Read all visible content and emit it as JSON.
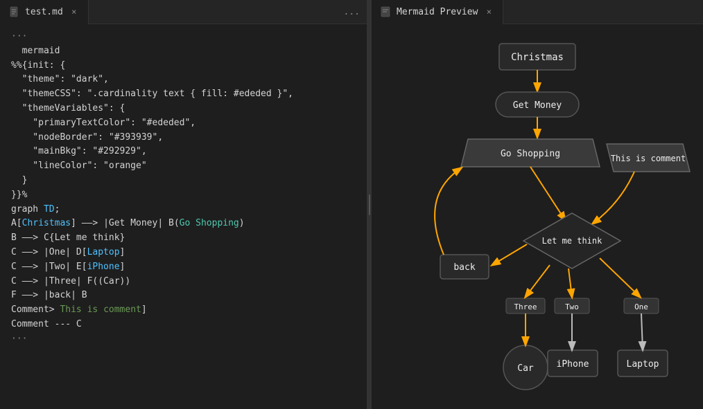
{
  "editor": {
    "tab": {
      "label": "test.md",
      "close_icon": "×",
      "more_icon": "..."
    },
    "lines": [
      {
        "id": 1,
        "content": "···",
        "class": "c-gray"
      },
      {
        "id": 2,
        "content": "  mermaid",
        "class": "c-white"
      },
      {
        "id": 3,
        "content": "%%{init: {",
        "class": "c-white"
      },
      {
        "id": 4,
        "content": "  \"theme\": \"dark\",",
        "class": "c-white"
      },
      {
        "id": 5,
        "content": "  \"themeCSS\": \".cardinality text { fill: #ededed }\",",
        "class": "c-white"
      },
      {
        "id": 6,
        "content": "  \"themeVariables\": {",
        "class": "c-white"
      },
      {
        "id": 7,
        "content": "    \"primaryTextColor\": \"#ededed\",",
        "class": "c-white"
      },
      {
        "id": 8,
        "content": "    \"nodeBorder\": \"#393939\",",
        "class": "c-white"
      },
      {
        "id": 9,
        "content": "    \"mainBkg\": \"#292929\",",
        "class": "c-white"
      },
      {
        "id": 10,
        "content": "    \"lineColor\": \"orange\"",
        "class": "c-white"
      },
      {
        "id": 11,
        "content": "  }",
        "class": "c-white"
      },
      {
        "id": 12,
        "content": "}}%",
        "class": "c-white"
      },
      {
        "id": 13,
        "content": "graph TD;",
        "class": "c-white"
      },
      {
        "id": 14,
        "content": "A[Christmas] --> |Get Money| B(Go Shopping)",
        "classes": [
          {
            "text": "A[",
            "c": "c-white"
          },
          {
            "text": "Christmas",
            "c": "c-cyan"
          },
          {
            "text": "] --> |Get Money| B(",
            "c": "c-white"
          },
          {
            "text": "Go Shopping",
            "c": "c-teal"
          },
          {
            "text": ")",
            "c": "c-white"
          }
        ]
      },
      {
        "id": 15,
        "content": "B --> C{Let me think}",
        "classes": [
          {
            "text": "B --> C{",
            "c": "c-white"
          },
          {
            "text": "Let me think",
            "c": "c-white"
          },
          {
            "text": "}",
            "c": "c-white"
          }
        ]
      },
      {
        "id": 16,
        "content": "C --> |One| D[Laptop]",
        "classes": [
          {
            "text": "C --> |One| D[",
            "c": "c-white"
          },
          {
            "text": "Laptop",
            "c": "c-cyan"
          },
          {
            "text": "]",
            "c": "c-white"
          }
        ]
      },
      {
        "id": 17,
        "content": "C --> |Two| E[iPhone]",
        "classes": [
          {
            "text": "C --> |Two| E[",
            "c": "c-white"
          },
          {
            "text": "iPhone",
            "c": "c-cyan"
          },
          {
            "text": "]",
            "c": "c-white"
          }
        ]
      },
      {
        "id": 18,
        "content": "C --> |Three| F((Car))",
        "class": "c-white"
      },
      {
        "id": 19,
        "content": "F --> |back| B",
        "class": "c-white"
      },
      {
        "id": 20,
        "content": "Comment> This is comment]",
        "classes": [
          {
            "text": "Comment> ",
            "c": "c-white"
          },
          {
            "text": "This is comment",
            "c": "c-comment"
          },
          {
            "text": "]",
            "c": "c-white"
          }
        ]
      },
      {
        "id": 21,
        "content": "Comment --- C",
        "class": "c-white"
      },
      {
        "id": 22,
        "content": "···",
        "class": "c-gray"
      }
    ]
  },
  "preview": {
    "tab": {
      "label": "Mermaid Preview",
      "close_icon": "×"
    }
  },
  "diagram": {
    "nodes": {
      "christmas": "Christmas",
      "getMoney": "Get Money",
      "goShopping": "Go Shopping",
      "comment": "This is comment",
      "letMeThink": "Let me think",
      "back": "back",
      "three": "Three",
      "two": "Two",
      "one": "One",
      "car": "Car",
      "iPhone": "iPhone",
      "laptop": "Laptop"
    },
    "colors": {
      "nodeBg": "#292929",
      "nodeBorder": "#555",
      "text": "#ededed",
      "arrow": "orange",
      "diamond": "#2a2a2a",
      "circle": "#292929"
    }
  }
}
